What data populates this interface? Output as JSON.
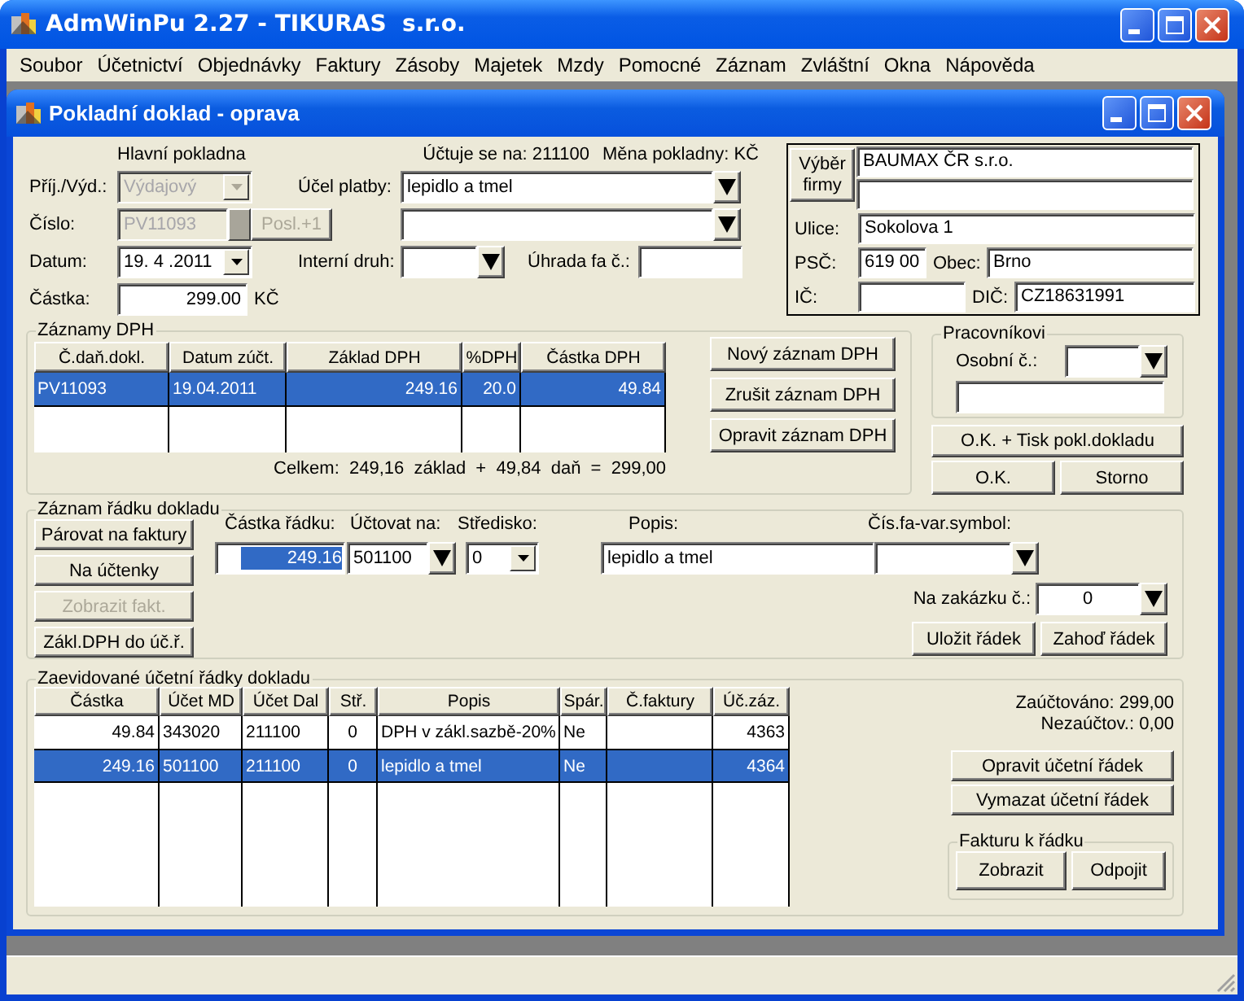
{
  "app": {
    "title": "AdmWinPu 2.27 - TIKURAS  s.r.o."
  },
  "menu": [
    {
      "label": "Soubor"
    },
    {
      "label": "Účetnictví"
    },
    {
      "label": "Objednávky"
    },
    {
      "label": "Faktury"
    },
    {
      "label": "Zásoby"
    },
    {
      "label": "Majetek"
    },
    {
      "label": "Mzdy"
    },
    {
      "label": "Pomocné"
    },
    {
      "label": "Záznam"
    },
    {
      "label": "Zvláštní"
    },
    {
      "label": "Okna"
    },
    {
      "label": "Nápověda"
    }
  ],
  "window": {
    "title": "Pokladní doklad - oprava"
  },
  "header": {
    "cash_desk": "Hlavní pokladna",
    "account_info": "Účtuje se na: 211100",
    "currency_info": "Měna pokladny: KČ",
    "type": {
      "label": "Příj./Výd.:",
      "value": "Výdajový",
      "disabled": true
    },
    "purpose": {
      "label": "Účel platby:",
      "value": "lepidlo a tmel"
    },
    "number": {
      "label": "Číslo:",
      "value": "PV11093",
      "disabled": true
    },
    "next_button": {
      "label": "Posl.+1",
      "disabled": true
    },
    "date": {
      "label": "Datum:",
      "value": "19. 4 .2011"
    },
    "internal_type": {
      "label": "Interní druh:"
    },
    "invoice_payment": {
      "label": "Úhrada fa č.:"
    },
    "amount": {
      "label": "Částka:",
      "value": "299.00",
      "unit": "KČ"
    }
  },
  "firm": {
    "select_button": "Výběr firmy",
    "name": "BAUMAX ČR s.r.o.",
    "street_label": "Ulice:",
    "street": "Sokolova 1",
    "zip_label": "PSČ:",
    "zip": "619 00",
    "city_label": "Obec:",
    "city": "Brno",
    "id_label": "IČ:",
    "vat_id_label": "DIČ:",
    "vat_id": "CZ18631991"
  },
  "vat_records": {
    "title": "Záznamy DPH",
    "columns": [
      "Č.daň.dokl.",
      "Datum zúčt.",
      "Základ DPH",
      "%DPH",
      "Částka DPH"
    ],
    "rows": [
      {
        "cells": [
          "PV11093",
          "19.04.2011",
          "249.16",
          "20.0",
          "49.84"
        ],
        "selected": true
      }
    ],
    "total": "Celkem:  249,16  základ  +  49,84  daň  =  299,00",
    "buttons": [
      "Nový záznam DPH",
      "Zrušit záznam DPH",
      "Opravit záznam DPH"
    ]
  },
  "worker": {
    "title": "Pracovníkovi",
    "personal_no_label": "Osobní č.:"
  },
  "actions": [
    "O.K. + Tisk pokl.dokladu",
    "O.K.",
    "Storno"
  ],
  "line_entry": {
    "title": "Záznam řádku dokladu",
    "buttons": [
      {
        "label": "Párovat na faktury",
        "disabled": false
      },
      {
        "label": "Na účtenky",
        "disabled": false
      },
      {
        "label": "Zobrazit fakt.",
        "disabled": true
      },
      {
        "label": "Zákl.DPH do úč.ř.",
        "disabled": false
      }
    ],
    "amount": {
      "label": "Částka řádku:",
      "value": "249.16",
      "text_selected": true
    },
    "account": {
      "label": "Účtovat na:",
      "value": "501100"
    },
    "center": {
      "label": "Středisko:",
      "value": "0"
    },
    "description": {
      "label": "Popis:",
      "value": "lepidlo a tmel"
    },
    "invoice_symbol": {
      "label": "Čís.fa-var.symbol:"
    },
    "order": {
      "label": "Na zakázku č.:",
      "value": "0"
    },
    "row_buttons": [
      "Uložit řádek",
      "Zahoď řádek"
    ]
  },
  "posted_lines": {
    "title": "Zaevidované účetní řádky dokladu",
    "columns": [
      "Částka",
      "Účet MD",
      "Účet Dal",
      "Stř.",
      "Popis",
      "Spár.",
      "Č.faktury",
      "Úč.záz."
    ],
    "rows": [
      {
        "cells": [
          "49.84",
          "343020",
          "211100",
          "0",
          "DPH v zákl.sazbě-20%",
          "Ne",
          null,
          "4363"
        ],
        "selected": false
      },
      {
        "cells": [
          "249.16",
          "501100",
          "211100",
          "0",
          "lepidlo a tmel",
          "Ne",
          null,
          "4364"
        ],
        "selected": true
      }
    ],
    "posted": "Zaúčtováno: 299,00",
    "unposted": "Nezaúčtov.: 0,00",
    "buttons": [
      "Opravit účetní řádek",
      "Vymazat účetní řádek"
    ],
    "invoice_group": {
      "title": "Fakturu k řádku",
      "buttons": [
        "Zobrazit",
        "Odpojit"
      ]
    }
  }
}
